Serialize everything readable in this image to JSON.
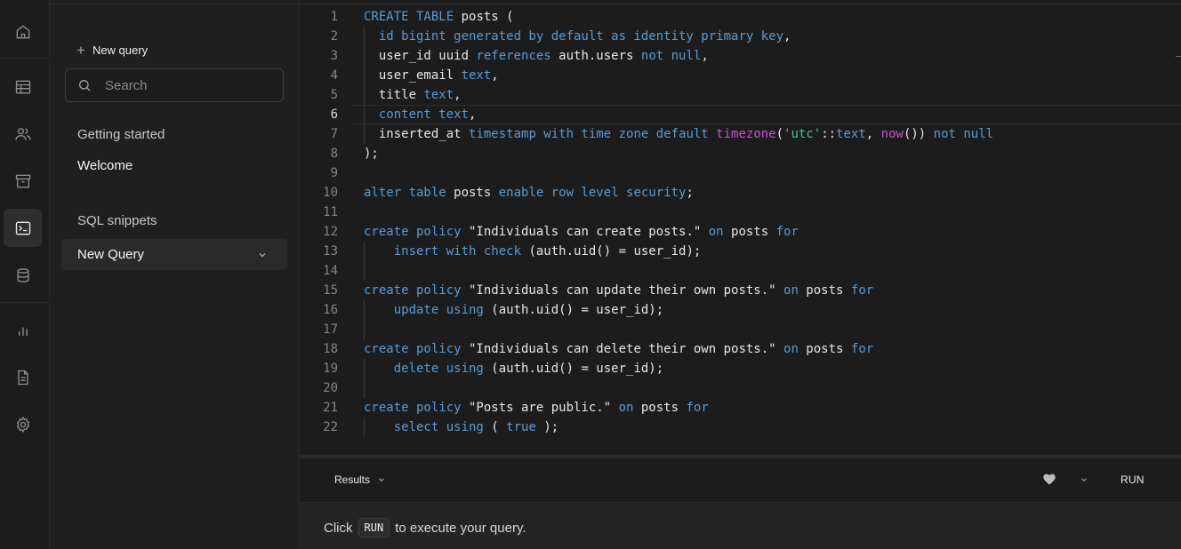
{
  "rail": {
    "items": [
      {
        "name": "home-icon"
      },
      {
        "name": "table-editor-icon"
      },
      {
        "name": "users-icon"
      },
      {
        "name": "storage-icon"
      },
      {
        "name": "sql-editor-icon",
        "active": true
      },
      {
        "name": "database-icon"
      },
      {
        "name": "reports-icon"
      },
      {
        "name": "docs-icon"
      },
      {
        "name": "settings-icon"
      }
    ]
  },
  "sidebar": {
    "new_query_label": "New query",
    "search_placeholder": "Search",
    "getting_started": "Getting started",
    "welcome": "Welcome",
    "sql_snippets": "SQL snippets",
    "selected_query": "New Query"
  },
  "editor": {
    "current_line": 6,
    "lines": [
      {
        "n": "1",
        "tokens": [
          [
            "kw",
            "CREATE TABLE"
          ],
          [
            "t",
            " posts "
          ],
          [
            "t",
            "("
          ]
        ]
      },
      {
        "n": "2",
        "tokens": [
          [
            "t",
            "  "
          ],
          [
            "kw",
            "id bigint generated by default as identity primary key"
          ],
          [
            "t",
            ","
          ]
        ]
      },
      {
        "n": "3",
        "tokens": [
          [
            "t",
            "  user_id uuid "
          ],
          [
            "kw",
            "references"
          ],
          [
            "t",
            " auth.users "
          ],
          [
            "kw",
            "not null"
          ],
          [
            "t",
            ","
          ]
        ]
      },
      {
        "n": "4",
        "tokens": [
          [
            "t",
            "  user_email "
          ],
          [
            "kw",
            "text"
          ],
          [
            "t",
            ","
          ]
        ]
      },
      {
        "n": "5",
        "tokens": [
          [
            "t",
            "  title "
          ],
          [
            "kw",
            "text"
          ],
          [
            "t",
            ","
          ]
        ]
      },
      {
        "n": "6",
        "tokens": [
          [
            "t",
            "  "
          ],
          [
            "kw",
            "content text"
          ],
          [
            "t",
            ","
          ]
        ]
      },
      {
        "n": "7",
        "tokens": [
          [
            "t",
            "  inserted_at "
          ],
          [
            "kw",
            "timestamp with time zone default "
          ],
          [
            "fn",
            "timezone"
          ],
          [
            "t",
            "("
          ],
          [
            "str",
            "'utc'"
          ],
          [
            "t",
            "::"
          ],
          [
            "kw",
            "text"
          ],
          [
            "t",
            ", "
          ],
          [
            "fn",
            "now"
          ],
          [
            "t",
            "()) "
          ],
          [
            "kw",
            "not null"
          ]
        ]
      },
      {
        "n": "8",
        "tokens": [
          [
            "t",
            ");"
          ]
        ]
      },
      {
        "n": "9",
        "tokens": []
      },
      {
        "n": "10",
        "tokens": [
          [
            "kw",
            "alter table"
          ],
          [
            "t",
            " posts "
          ],
          [
            "kw",
            "enable row level security"
          ],
          [
            "t",
            ";"
          ]
        ]
      },
      {
        "n": "11",
        "tokens": []
      },
      {
        "n": "12",
        "tokens": [
          [
            "kw",
            "create policy"
          ],
          [
            "t",
            " \"Individuals can create posts.\" "
          ],
          [
            "kw",
            "on"
          ],
          [
            "t",
            " posts "
          ],
          [
            "kw",
            "for"
          ]
        ]
      },
      {
        "n": "13",
        "tokens": [
          [
            "t",
            "    "
          ],
          [
            "kw",
            "insert with check"
          ],
          [
            "t",
            " (auth.uid() = user_id);"
          ]
        ]
      },
      {
        "n": "14",
        "tokens": []
      },
      {
        "n": "15",
        "tokens": [
          [
            "kw",
            "create policy"
          ],
          [
            "t",
            " \"Individuals can update their own posts.\" "
          ],
          [
            "kw",
            "on"
          ],
          [
            "t",
            " posts "
          ],
          [
            "kw",
            "for"
          ]
        ]
      },
      {
        "n": "16",
        "tokens": [
          [
            "t",
            "    "
          ],
          [
            "kw",
            "update using"
          ],
          [
            "t",
            " (auth.uid() = user_id);"
          ]
        ]
      },
      {
        "n": "17",
        "tokens": []
      },
      {
        "n": "18",
        "tokens": [
          [
            "kw",
            "create policy"
          ],
          [
            "t",
            " \"Individuals can delete their own posts.\" "
          ],
          [
            "kw",
            "on"
          ],
          [
            "t",
            " posts "
          ],
          [
            "kw",
            "for"
          ]
        ]
      },
      {
        "n": "19",
        "tokens": [
          [
            "t",
            "    "
          ],
          [
            "kw",
            "delete using"
          ],
          [
            "t",
            " (auth.uid() = user_id);"
          ]
        ]
      },
      {
        "n": "20",
        "tokens": []
      },
      {
        "n": "21",
        "tokens": [
          [
            "kw",
            "create policy"
          ],
          [
            "t",
            " \"Posts are public.\" "
          ],
          [
            "kw",
            "on"
          ],
          [
            "t",
            " posts "
          ],
          [
            "kw",
            "for"
          ]
        ]
      },
      {
        "n": "22",
        "tokens": [
          [
            "t",
            "    "
          ],
          [
            "kw",
            "select using"
          ],
          [
            "t",
            " ( "
          ],
          [
            "kw",
            "true"
          ],
          [
            "t",
            " );"
          ]
        ]
      }
    ]
  },
  "results": {
    "tab_label": "Results",
    "run_label": "RUN",
    "hint_before": "Click",
    "hint_kbd": "RUN",
    "hint_after": "to execute your query."
  }
}
